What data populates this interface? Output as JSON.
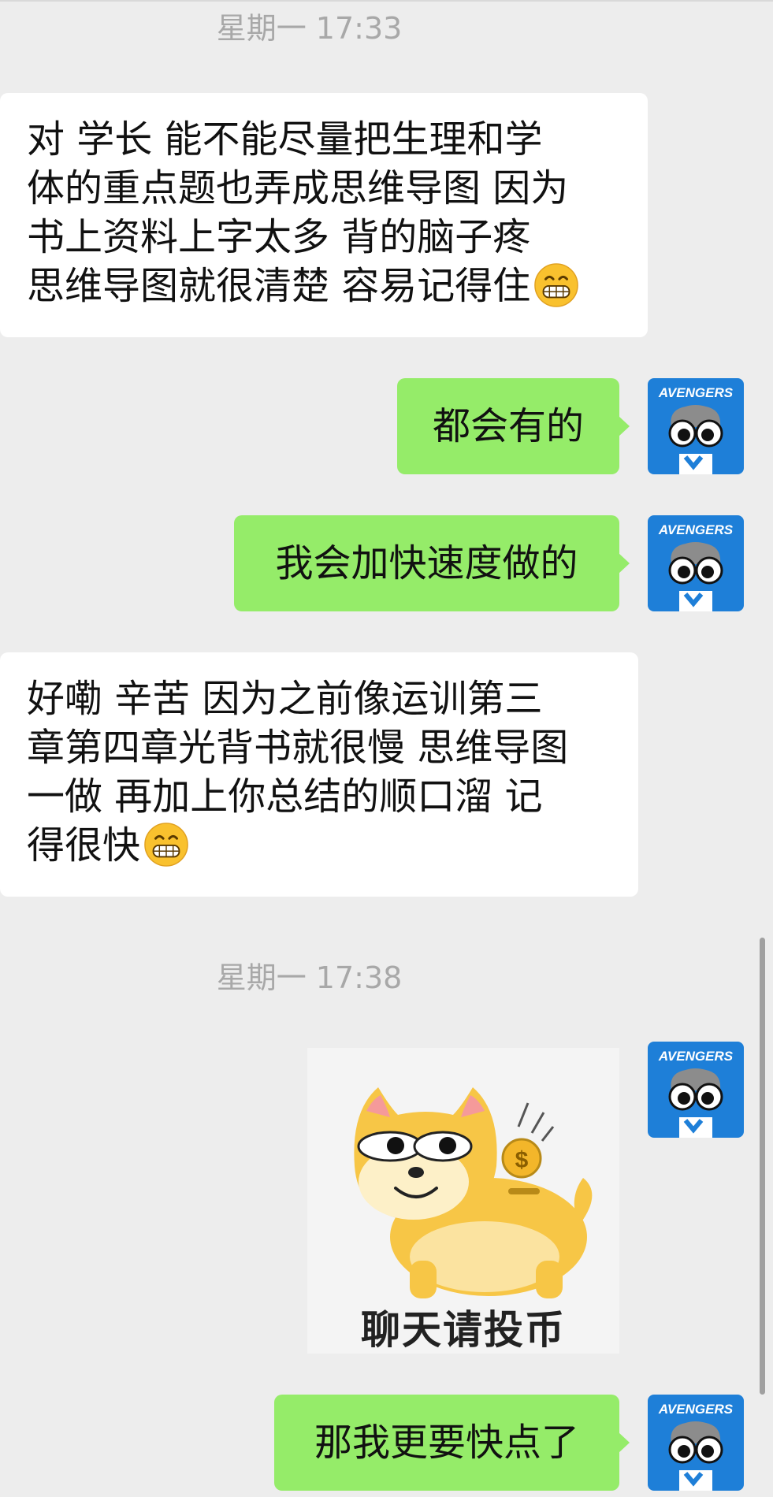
{
  "timestamps": {
    "first": "星期一 17:33",
    "second": "星期一 17:38"
  },
  "messages": [
    {
      "side": "incoming",
      "lines": [
        "对 学长 能不能尽量把生理和学",
        "体的重点题也弄成思维导图 因为",
        "书上资料上字太多 背的脑子疼",
        "思维导图就很清楚 容易记得住"
      ],
      "trailing_icon": "grinning-emoji"
    },
    {
      "side": "outgoing",
      "text": "都会有的",
      "avatar_icon": "avengers-avatar-icon"
    },
    {
      "side": "outgoing",
      "text": "我会加快速度做的",
      "avatar_icon": "avengers-avatar-icon"
    },
    {
      "side": "incoming",
      "lines": [
        "好嘞 辛苦 因为之前像运训第三",
        "章第四章光背书就很慢 思维导图",
        "一做 再加上你总结的顺口溜 记",
        "得很快"
      ],
      "trailing_icon": "grinning-emoji"
    },
    {
      "side": "outgoing",
      "type": "sticker",
      "sticker_icon": "shiba-piggy-bank-sticker",
      "caption": "聊天请投币",
      "avatar_icon": "avengers-avatar-icon"
    },
    {
      "side": "outgoing",
      "text": "那我更要快点了",
      "avatar_icon": "avengers-avatar-icon"
    }
  ],
  "avatar": {
    "logo_text": "AVENGERS"
  },
  "colors": {
    "background": "#ededed",
    "outgoing_bubble": "#95ec69",
    "incoming_bubble": "#ffffff",
    "timestamp_text": "#a8a8a8",
    "avatar_bg": "#1e7fd8"
  }
}
